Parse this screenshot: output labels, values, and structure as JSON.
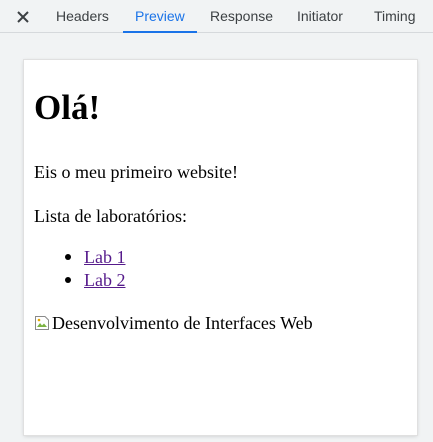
{
  "tabs": [
    {
      "label": "Headers"
    },
    {
      "label": "Preview"
    },
    {
      "label": "Response"
    },
    {
      "label": "Initiator"
    },
    {
      "label": "Timing"
    }
  ],
  "active_tab": "Preview",
  "colors": {
    "accent": "#1a73e8",
    "link": "#551a8b"
  },
  "icons": {
    "close": "close-icon",
    "broken_image": "broken-image-icon"
  },
  "preview": {
    "heading": "Olá!",
    "intro": "Eis o meu primeiro website!",
    "list_title": "Lista de laboratórios:",
    "labs": [
      "Lab 1",
      "Lab 2"
    ],
    "image_alt": "Desenvolvimento de Interfaces Web"
  }
}
